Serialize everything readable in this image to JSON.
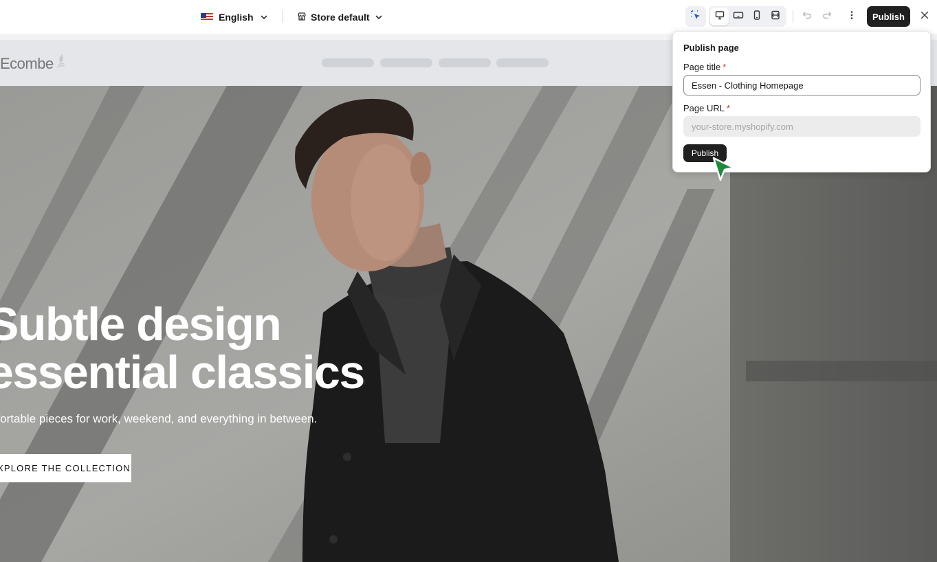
{
  "topbar": {
    "language": "English",
    "language_flag": "us-flag-icon",
    "store": "Store default",
    "publish_label": "Publish"
  },
  "icons": {
    "select": "select-element-icon",
    "desktop": "desktop-icon",
    "tablet_landscape": "tablet-landscape-icon",
    "mobile": "mobile-icon",
    "fit": "fit-width-icon",
    "undo": "undo-icon",
    "redo": "redo-icon",
    "more": "more-vertical-icon",
    "close": "close-icon"
  },
  "popover": {
    "title": "Publish page",
    "page_title_label": "Page title",
    "page_title_value": "Essen - Clothing Homepage",
    "page_url_label": "Page URL",
    "page_url_placeholder": "your-store.myshopify.com",
    "required_mark": "*",
    "publish_label": "Publish"
  },
  "site": {
    "logo": "Ecombe",
    "hero": {
      "title": "Subtle design\nessential classics",
      "subtitle": "nfortable pieces for work, weekend, and everything in between.",
      "cta": "XPLORE THE COLLECTION"
    }
  },
  "colors": {
    "accent_dark": "#202020",
    "required": "#c0392b",
    "cursor": "#1e8a3c"
  }
}
